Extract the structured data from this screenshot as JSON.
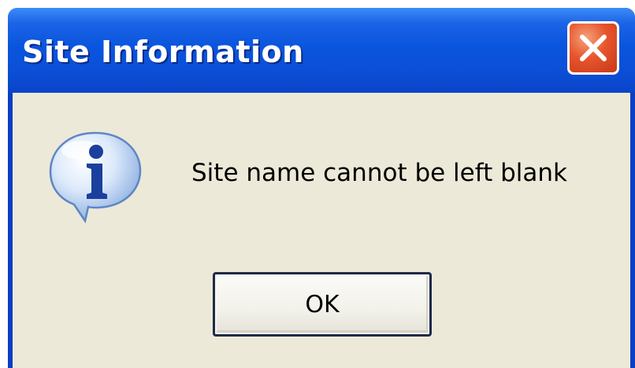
{
  "dialog": {
    "title": "Site Information",
    "message": "Site name cannot be left blank",
    "ok_label": "OK",
    "icons": {
      "message_icon": "information-icon",
      "close_icon": "close-icon"
    },
    "colors": {
      "titlebar": "#0a55de",
      "close_button": "#e6552b",
      "client_background": "#ece9d8"
    }
  }
}
